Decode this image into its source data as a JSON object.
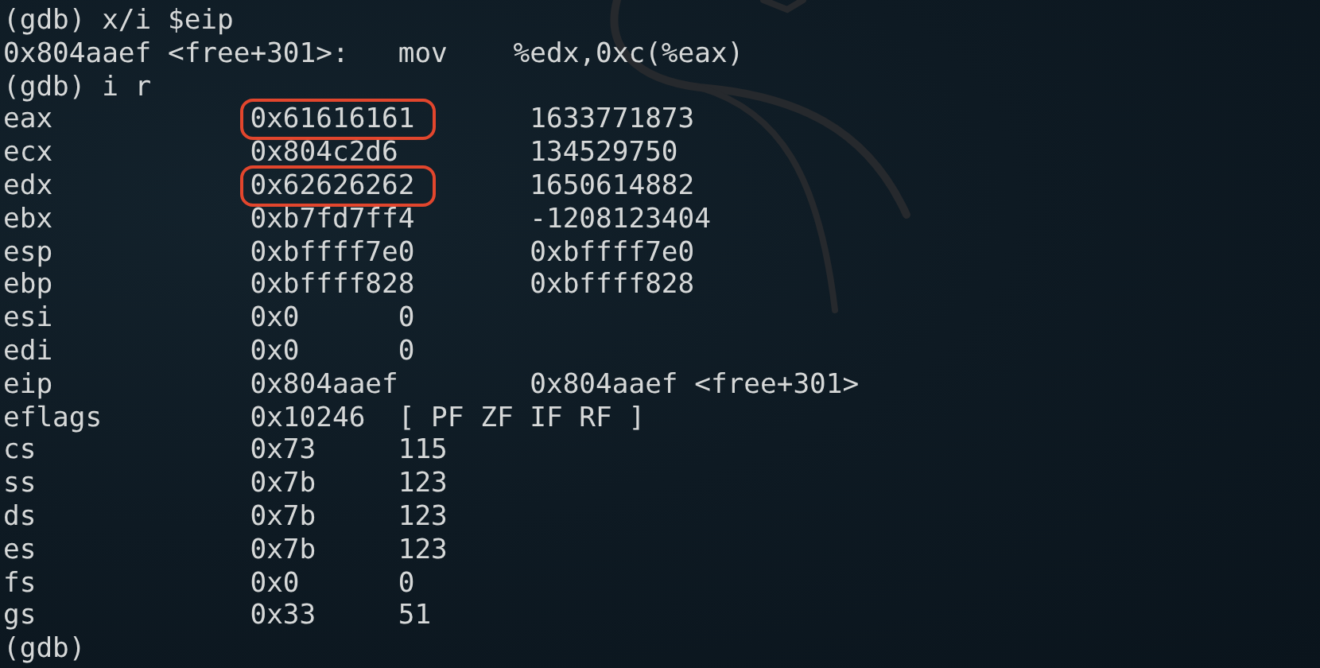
{
  "terminal": {
    "lines": [
      {
        "kind": "text",
        "text": "(gdb) x/i $eip"
      },
      {
        "kind": "text",
        "text": "0x804aaef <free+301>:   mov    %edx,0xc(%eax)"
      },
      {
        "kind": "text",
        "text": "(gdb) i r"
      },
      {
        "kind": "register",
        "name": "eax",
        "value": "0x61616161",
        "natural": "1633771873",
        "highlighted": true
      },
      {
        "kind": "register",
        "name": "ecx",
        "value": "0x804c2d6",
        "natural": "134529750",
        "highlighted": false
      },
      {
        "kind": "register",
        "name": "edx",
        "value": "0x62626262",
        "natural": "1650614882",
        "highlighted": true
      },
      {
        "kind": "register",
        "name": "ebx",
        "value": "0xb7fd7ff4",
        "natural": "-1208123404",
        "highlighted": false
      },
      {
        "kind": "register",
        "name": "esp",
        "value": "0xbffff7e0",
        "natural": "0xbffff7e0",
        "highlighted": false
      },
      {
        "kind": "register",
        "name": "ebp",
        "value": "0xbffff828",
        "natural": "0xbffff828",
        "highlighted": false
      },
      {
        "kind": "register",
        "name": "esi",
        "value": "0x0",
        "natural": "0",
        "highlighted": false
      },
      {
        "kind": "register",
        "name": "edi",
        "value": "0x0",
        "natural": "0",
        "highlighted": false
      },
      {
        "kind": "register",
        "name": "eip",
        "value": "0x804aaef",
        "natural": "0x804aaef <free+301>",
        "highlighted": false
      },
      {
        "kind": "register",
        "name": "eflags",
        "value": "0x10246",
        "natural": "[ PF ZF IF RF ]",
        "highlighted": false
      },
      {
        "kind": "register",
        "name": "cs",
        "value": "0x73",
        "natural": "115",
        "highlighted": false
      },
      {
        "kind": "register",
        "name": "ss",
        "value": "0x7b",
        "natural": "123",
        "highlighted": false
      },
      {
        "kind": "register",
        "name": "ds",
        "value": "0x7b",
        "natural": "123",
        "highlighted": false
      },
      {
        "kind": "register",
        "name": "es",
        "value": "0x7b",
        "natural": "123",
        "highlighted": false
      },
      {
        "kind": "register",
        "name": "fs",
        "value": "0x0",
        "natural": "0",
        "highlighted": false
      },
      {
        "kind": "register",
        "name": "gs",
        "value": "0x33",
        "natural": "51",
        "highlighted": false
      },
      {
        "kind": "text",
        "text": "(gdb)"
      }
    ]
  }
}
